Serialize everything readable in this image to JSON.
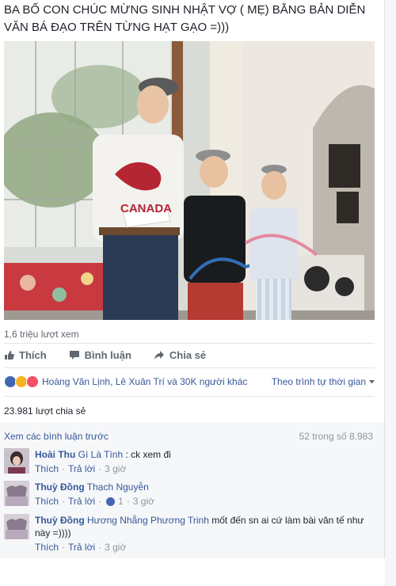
{
  "post": {
    "text": "BA BỐ CON CHÚC MỪNG SINH NHẬT VỢ ( MẸ) BẰNG BẢN DIỄN VĂN BÁ ĐẠO TRÊN TỪNG HẠT GẠO =)))"
  },
  "video": {
    "shirt_text": "CANADA"
  },
  "stats": {
    "views": "1,6 triệu lượt xem",
    "shares": "23.981 lượt chia sẻ"
  },
  "actions": {
    "like": "Thích",
    "comment": "Bình luận",
    "share": "Chia sẻ"
  },
  "reactions": {
    "names": "Hoàng Văn Lịnh, Lê Xuân Trí và 30K người khác",
    "sort": "Theo trình tự thời gian",
    "colors": {
      "like": "#4267b2",
      "haha": "#f7b125",
      "love": "#f25268"
    }
  },
  "comments_header": {
    "view_previous": "Xem các bình luận trước",
    "count": "52 trong số 8.983"
  },
  "comments": [
    {
      "author": "Hoài Thu",
      "tag": "Gì Là Tình",
      "text": ": ck xem đi",
      "like": "Thích",
      "reply": "Trả lời",
      "time": "3 giờ",
      "likes": ""
    },
    {
      "author": "Thuỳ Đồng",
      "tag": "Thạch Nguyễn",
      "text": "",
      "like": "Thích",
      "reply": "Trả lời",
      "time": "3 giờ",
      "likes": "1"
    },
    {
      "author": "Thuỳ Đồng",
      "tag": "Hương Nhẵng Phương Trinh",
      "text": "mốt đến sn ai cứ làm bài văn tế như này =))))",
      "like": "Thích",
      "reply": "Trả lời",
      "time": "3 giờ",
      "likes": ""
    }
  ]
}
